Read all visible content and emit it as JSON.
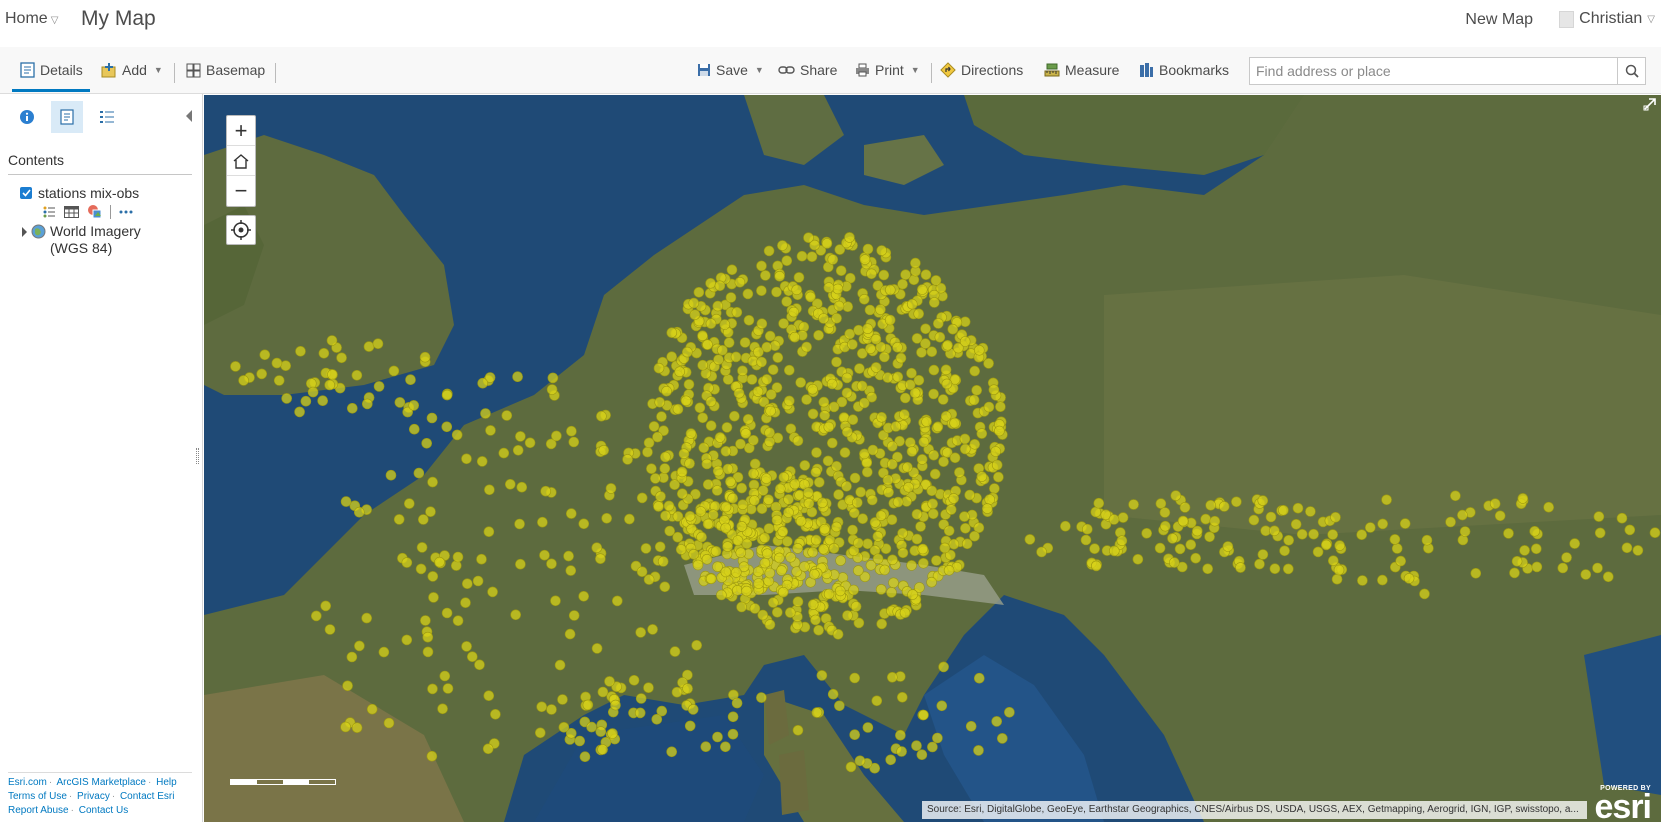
{
  "header": {
    "home_label": "Home",
    "map_title": "My Map",
    "new_map_label": "New Map",
    "user_name": "Christian"
  },
  "toolbar": {
    "details_label": "Details",
    "add_label": "Add",
    "basemap_label": "Basemap",
    "save_label": "Save",
    "share_label": "Share",
    "print_label": "Print",
    "directions_label": "Directions",
    "measure_label": "Measure",
    "bookmarks_label": "Bookmarks",
    "search_placeholder": "Find address or place"
  },
  "panel": {
    "contents_title": "Contents",
    "layers": [
      {
        "label": "stations mix-obs",
        "checked": true
      },
      {
        "label": "World Imagery (WGS 84)"
      }
    ],
    "footer_links": [
      "Esri.com",
      "ArcGIS Marketplace",
      "Help",
      "Terms of Use",
      "Privacy",
      "Contact Esri",
      "Report Abuse",
      "Contact Us"
    ]
  },
  "map": {
    "attribution": "Source: Esri, DigitalGlobe, GeoEye, Earthstar Geographics, CNES/Airbus DS, USDA, USGS, AEX, Getmapping, Aerogrid, IGN, IGP, swisstopo, a...",
    "powered_by": "POWERED BY",
    "logo_text": "esri",
    "point_color": "#d7d21a",
    "zoom_in": "+",
    "zoom_out": "−"
  },
  "colors": {
    "accent": "#0079c1",
    "sea": "#1e4672",
    "land": "#5d6b3e"
  }
}
